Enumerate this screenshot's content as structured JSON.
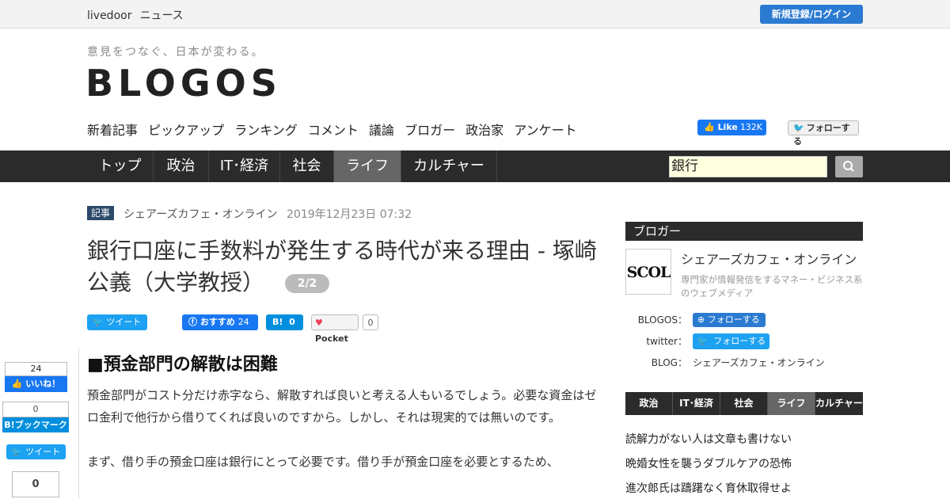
{
  "topbar": {
    "brand_a": "livedoor",
    "brand_b": "ニュース",
    "login_label": "新規登録/ログイン"
  },
  "header": {
    "tagline": "意見をつなぐ、日本が変わる。",
    "logo": "BLOGOS"
  },
  "subnav": [
    "新着記事",
    "ピックアップ",
    "ランキング",
    "コメント",
    "議論",
    "ブロガー",
    "政治家",
    "アンケート"
  ],
  "social": {
    "fb_like": "Like",
    "fb_count": "132K",
    "tw_follow": "フォローする"
  },
  "mainnav": {
    "tabs": [
      "トップ",
      "政治",
      "IT･経済",
      "社会",
      "ライフ",
      "カルチャー"
    ],
    "active": "ライフ",
    "search_value": "銀行"
  },
  "article": {
    "badge": "記事",
    "source": "シェアーズカフェ・オンライン",
    "date": "2019年12月23日 07:32",
    "title": "銀行口座に手数料が発生する時代が来る理由 - 塚崎公義（大学教授）",
    "page_badge": "2/2",
    "share": {
      "tweet": "ツイート",
      "fb": "おすすめ",
      "fb_count": "24",
      "hatena": "B!",
      "hatena_count": "0",
      "pocket": "Pocket",
      "pocket_count": "0"
    },
    "section_heading": "■預金部門の解散は困難",
    "paragraphs": [
      "預金部門がコスト分だけ赤字なら、解散すれば良いと考える人もいるでしょう。必要な資金はゼロ金利で他行から借りてくれば良いのですから。しかし、それは現実的では無いのです。",
      "まず、借り手の預金口座は銀行にとって必要です。借り手が預金口座を必要とするため、"
    ]
  },
  "floating_share": {
    "like_count": "24",
    "like": "いいね！",
    "hb_count": "0",
    "hb": "B!ブックマーク",
    "tweet": "ツイート",
    "pocket_count": "0"
  },
  "sidebar": {
    "title": "ブロガー",
    "logo_text": "SCOL",
    "name": "シェアーズカフェ・オンライン",
    "desc": "専門家が情報発信をするマネー・ビジネス系のウェブメディア",
    "blogos_label": "BLOGOS：",
    "blogos_follow": "フォローする",
    "twitter_label": "twitter：",
    "twitter_follow": "フォローする",
    "blog_label": "BLOG：",
    "blog_name": "シェアーズカフェ・オンライン",
    "tabs": [
      "政治",
      "IT･経済",
      "社会",
      "ライフ",
      "カルチャー"
    ],
    "active_tab": "ライフ",
    "articles": [
      "読解力がない人は文章も書けない",
      "晩婚女性を襲うダブルケアの恐怖",
      "進次郎氏は躊躇なく育休取得せよ"
    ]
  }
}
